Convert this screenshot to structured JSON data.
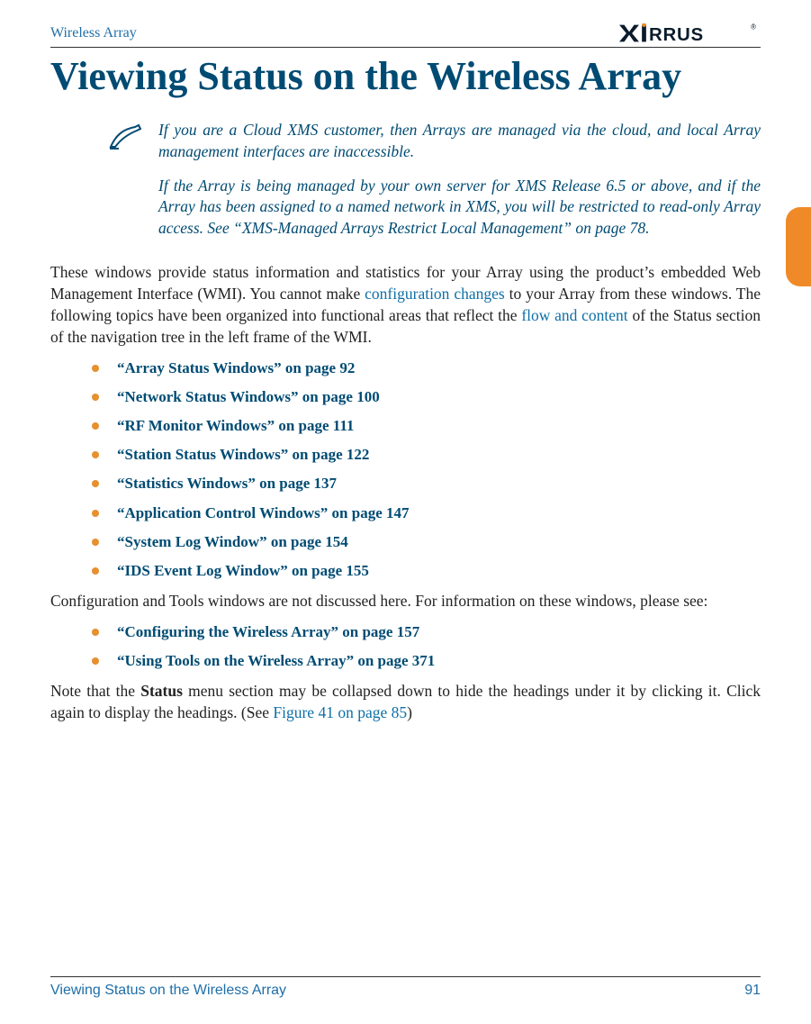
{
  "header": {
    "left": "Wireless Array",
    "brand_name": "XIRRUS"
  },
  "title": "Viewing Status on the Wireless Array",
  "note": {
    "p1": "If you are a Cloud XMS customer, then Arrays are managed via the cloud, and local Array management interfaces are inaccessible.",
    "p2": "If the Array is being managed by your own server for XMS Release 6.5 or above, and if the Array has been assigned to a named network in XMS, you will be restricted to read-only Array access. See “XMS-Managed Arrays Restrict Local Management” on page 78."
  },
  "para1": {
    "s1": "These windows provide status information and statistics for your Array using the product’s embedded Web Management Interface (WMI). You cannot make ",
    "link1": "configuration changes",
    "s2": " to your Array from these windows. The following topics have been organized into functional areas that reflect the ",
    "link2": "flow and content",
    "s3": " of the Status section of the navigation tree in the left frame of the WMI."
  },
  "list1": [
    "“Array Status Windows” on page 92",
    "“Network Status Windows” on page 100",
    "“RF Monitor Windows” on page 111",
    "“Station Status Windows” on page 122",
    "“Statistics Windows” on page 137",
    "“Application Control Windows” on page 147",
    "“System Log Window” on page 154",
    "“IDS Event Log Window” on page 155"
  ],
  "para2": "Configuration and Tools windows are not discussed here. For information on these windows, please see:",
  "list2": [
    "“Configuring the Wireless Array” on page 157",
    "“Using Tools on the Wireless Array” on page 371"
  ],
  "para3": {
    "s1": "Note that the ",
    "bold": "Status",
    "s2": " menu section may be collapsed down to hide the headings under it by clicking it. Click again to display the headings. (See ",
    "link": "Figure 41 on page 85",
    "s3": ")"
  },
  "footer": {
    "left": "Viewing Status on the Wireless Array",
    "right": "91"
  }
}
